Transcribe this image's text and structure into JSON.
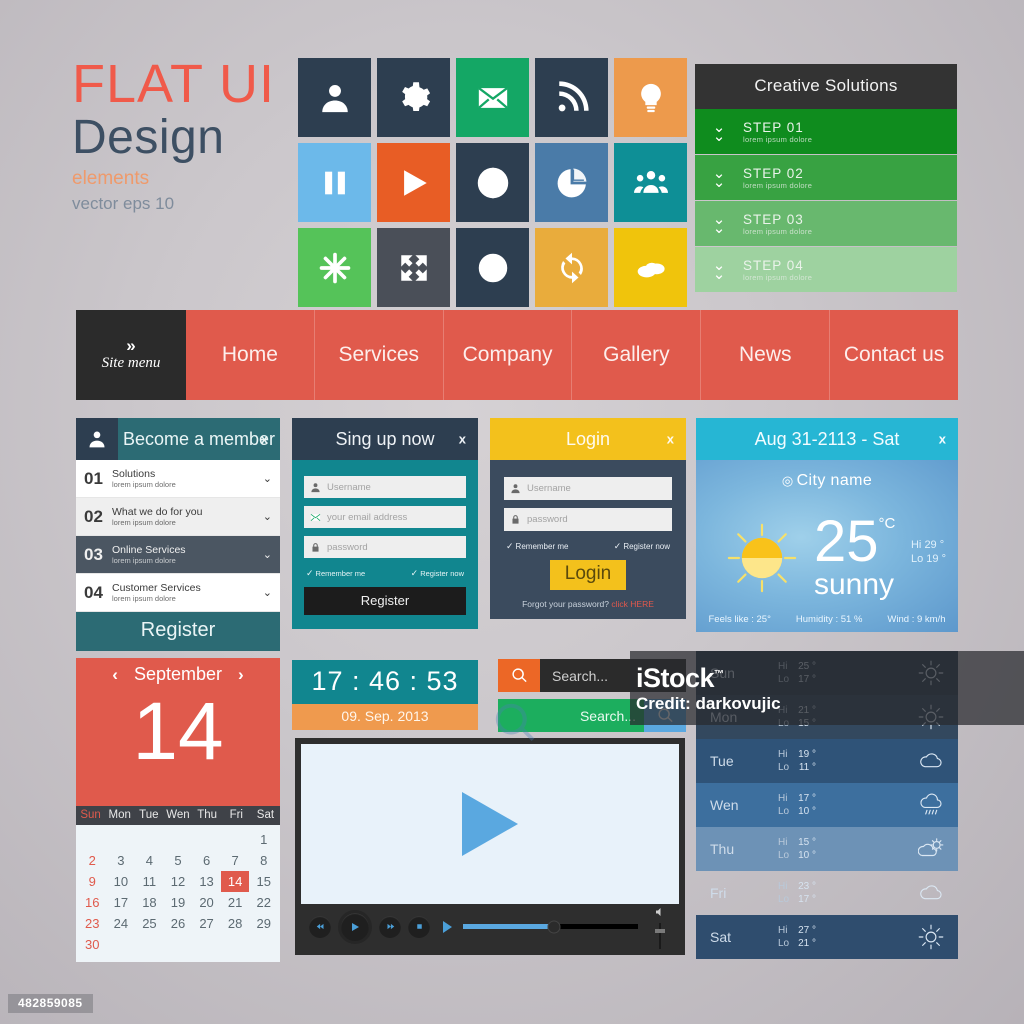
{
  "title": {
    "flat_ui": "FLAT UI",
    "design": "Design",
    "elements": "elements",
    "vector": "vector eps 10"
  },
  "icon_grid": {
    "tiles": [
      {
        "name": "user-icon",
        "color": "#2d3e50"
      },
      {
        "name": "gear-icon",
        "color": "#2d3e50"
      },
      {
        "name": "mail-icon",
        "color": "#14a765"
      },
      {
        "name": "rss-icon",
        "color": "#2d3e50"
      },
      {
        "name": "lightbulb-icon",
        "color": "#ed9a4c"
      },
      {
        "name": "pause-icon",
        "color": "#6cb9ea"
      },
      {
        "name": "play-icon",
        "color": "#e85d25"
      },
      {
        "name": "globe-icon",
        "color": "#2d3e50"
      },
      {
        "name": "pie-chart-icon",
        "color": "#4a7ba8"
      },
      {
        "name": "users-group-icon",
        "color": "#0e8f96"
      },
      {
        "name": "asterisk-icon",
        "color": "#55c359"
      },
      {
        "name": "expand-icon",
        "color": "#4a4f58"
      },
      {
        "name": "clock-icon",
        "color": "#2d3e50"
      },
      {
        "name": "refresh-icon",
        "color": "#e9ac3c"
      },
      {
        "name": "cloud-icon",
        "color": "#f0c40c"
      }
    ]
  },
  "accordion": {
    "header": "Creative Solutions",
    "rows": [
      {
        "title": "STEP 01",
        "sub": "lorem ipsum dolore",
        "color": "#0f8c1e"
      },
      {
        "title": "STEP 02",
        "sub": "lorem ipsum dolore",
        "color": "#38a242"
      },
      {
        "title": "STEP 03",
        "sub": "lorem ipsum dolore",
        "color": "#68b86e"
      },
      {
        "title": "STEP 04",
        "sub": "lorem ipsum dolore",
        "color": "#9ed2a0"
      }
    ]
  },
  "navbar": {
    "site_menu": "Site menu",
    "chevrons": "»",
    "items": [
      "Home",
      "Services",
      "Company",
      "Gallery",
      "News",
      "Contact us"
    ]
  },
  "member_panel": {
    "title": "Become a member",
    "close": "x",
    "rows": [
      {
        "num": "01",
        "name": "Solutions",
        "sub": "lorem ipsum dolore",
        "style": "light"
      },
      {
        "num": "02",
        "name": "What we do for you",
        "sub": "lorem ipsum dolore",
        "style": "alt"
      },
      {
        "num": "03",
        "name": "Online Services",
        "sub": "lorem ipsum dolore",
        "style": "dark"
      },
      {
        "num": "04",
        "name": "Customer Services",
        "sub": "lorem ipsum dolore",
        "style": "light"
      }
    ],
    "register": "Register"
  },
  "signup_panel": {
    "title": "Sing up now",
    "close": "x",
    "fields": [
      {
        "icon": "user-icon",
        "placeholder": "Username"
      },
      {
        "icon": "mail-icon",
        "placeholder": "your email address"
      },
      {
        "icon": "lock-icon",
        "placeholder": "password"
      }
    ],
    "remember_me": "Remember me",
    "register_now": "Register now",
    "button": "Register"
  },
  "login_panel": {
    "title": "Login",
    "close": "x",
    "fields": [
      {
        "icon": "user-icon",
        "placeholder": "Username"
      },
      {
        "icon": "lock-icon",
        "placeholder": "password"
      }
    ],
    "remember_me": "Remember me",
    "register_now": "Register now",
    "button": "Login",
    "forgot_text": "Forgot your password?",
    "forgot_link": "click HERE"
  },
  "weather": {
    "date": "Aug 31-2113 - Sat",
    "close": "x",
    "city": "City name",
    "temp": "25",
    "unit": "°C",
    "condition": "sunny",
    "hi_label": "Hi",
    "hi": "29 °",
    "lo_label": "Lo",
    "lo": "19 °",
    "feels_like": "Feels like : 25°",
    "humidity": "Humidity : 51 %",
    "wind": "Wind : 9 km/h"
  },
  "calendar": {
    "month": "September",
    "day": "14",
    "prev": "‹",
    "next": "›",
    "weekdays": [
      "Sun",
      "Mon",
      "Tue",
      "Wen",
      "Thu",
      "Fri",
      "Sat"
    ],
    "leading_blanks": 6,
    "days": [
      1,
      2,
      3,
      4,
      5,
      6,
      7,
      8,
      9,
      10,
      11,
      12,
      13,
      14,
      15,
      16,
      17,
      18,
      19,
      20,
      21,
      22,
      23,
      24,
      25,
      26,
      27,
      28,
      29,
      30
    ],
    "today": 14
  },
  "clock": {
    "time": "17 : 46 : 53",
    "date": "09. Sep. 2013"
  },
  "search": {
    "bar1_placeholder": "Search...",
    "bar2_placeholder": "Search...",
    "icon": "search-icon"
  },
  "video": {
    "play_icon": "play-icon",
    "rewind_icon": "rewind-icon",
    "forward_icon": "fast-forward-icon",
    "stop_icon": "stop-icon",
    "volume_icon": "volume-icon",
    "progress_percent": 52,
    "volume_percent": 75
  },
  "forecast": {
    "rows": [
      {
        "day": "Sun",
        "hi_label": "Hi",
        "hi": "25 °",
        "lo_label": "Lo",
        "lo": "17 °",
        "icon": "sun-icon",
        "color": "#2c3e50"
      },
      {
        "day": "Mon",
        "hi_label": "Hi",
        "hi": "21 °",
        "lo_label": "Lo",
        "lo": "15 °",
        "icon": "sun-icon",
        "color": "#33485e"
      },
      {
        "day": "Tue",
        "hi_label": "Hi",
        "hi": "19 °",
        "lo_label": "Lo",
        "lo": "11 °",
        "icon": "cloud-icon",
        "color": "#2f5378"
      },
      {
        "day": "Wen",
        "hi_label": "Hi",
        "hi": "17 °",
        "lo_label": "Lo",
        "lo": "10 °",
        "icon": "rain-icon",
        "color": "#3d6f9e"
      },
      {
        "day": "Thu",
        "hi_label": "Hi",
        "hi": "15 °",
        "lo_label": "Lo",
        "lo": "10 °",
        "icon": "partly-sun-icon",
        "color": "#6d92b6"
      },
      {
        "day": "Fri",
        "hi_label": "Hi",
        "hi": "23 °",
        "lo_label": "Lo",
        "lo": "17 °",
        "icon": "cloud-icon",
        "color": "#3e6député"
      },
      {
        "day": "Sat",
        "hi_label": "Hi",
        "hi": "27 °",
        "lo_label": "Lo",
        "lo": "21 °",
        "icon": "sun-icon",
        "color": "#2f4d6e"
      }
    ]
  },
  "watermark": {
    "istock": "iStock",
    "tm": "™",
    "credit": "Credit: darkovujic",
    "id": "482859085"
  }
}
